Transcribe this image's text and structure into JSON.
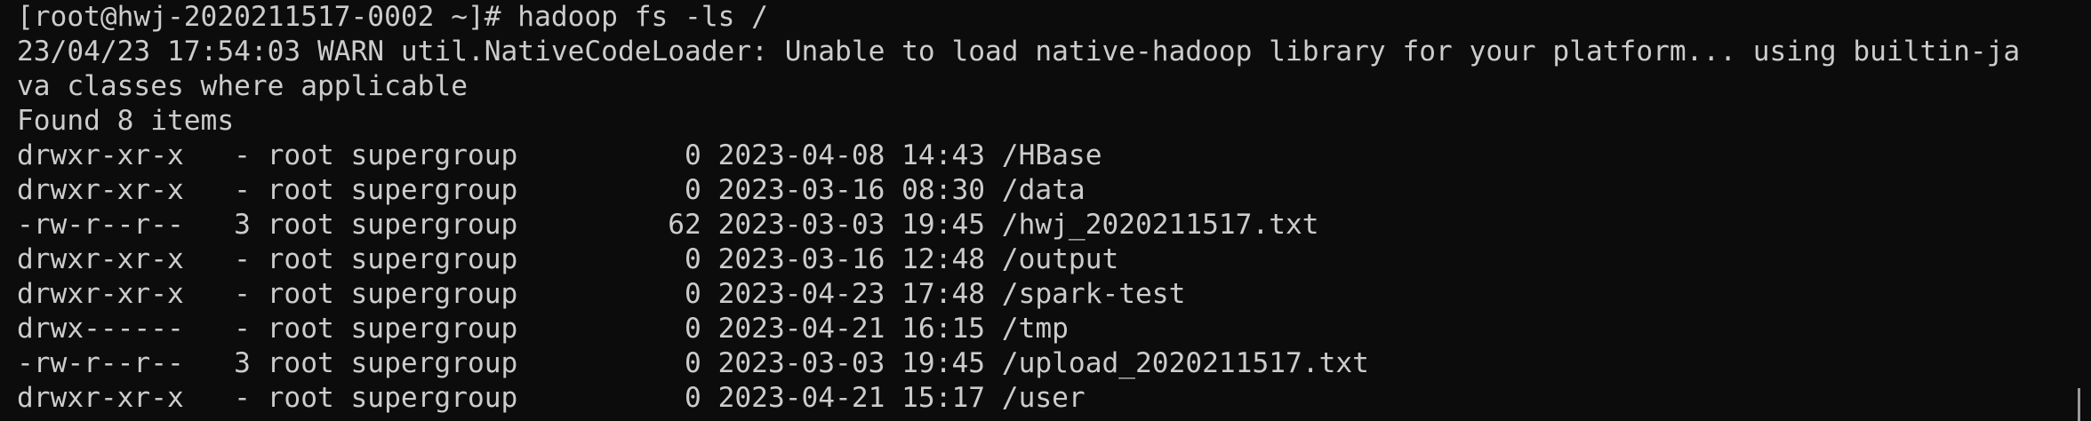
{
  "terminal": {
    "prompt_line": "[root@hwj-2020211517-0002 ~]# hadoop fs -ls /",
    "warn_line_1": "23/04/23 17:54:03 WARN util.NativeCodeLoader: Unable to load native-hadoop library for your platform... using builtin-ja",
    "warn_line_2": "va classes where applicable",
    "found_line": "Found 8 items",
    "entries": [
      "drwxr-xr-x   - root supergroup          0 2023-04-08 14:43 /HBase",
      "drwxr-xr-x   - root supergroup          0 2023-03-16 08:30 /data",
      "-rw-r--r--   3 root supergroup         62 2023-03-03 19:45 /hwj_2020211517.txt",
      "drwxr-xr-x   - root supergroup          0 2023-03-16 12:48 /output",
      "drwxr-xr-x   - root supergroup          0 2023-04-23 17:48 /spark-test",
      "drwx------   - root supergroup          0 2023-04-21 16:15 /tmp",
      "-rw-r--r--   3 root supergroup          0 2023-03-03 19:45 /upload_2020211517.txt",
      "drwxr-xr-x   - root supergroup          0 2023-04-21 15:17 /user"
    ]
  }
}
